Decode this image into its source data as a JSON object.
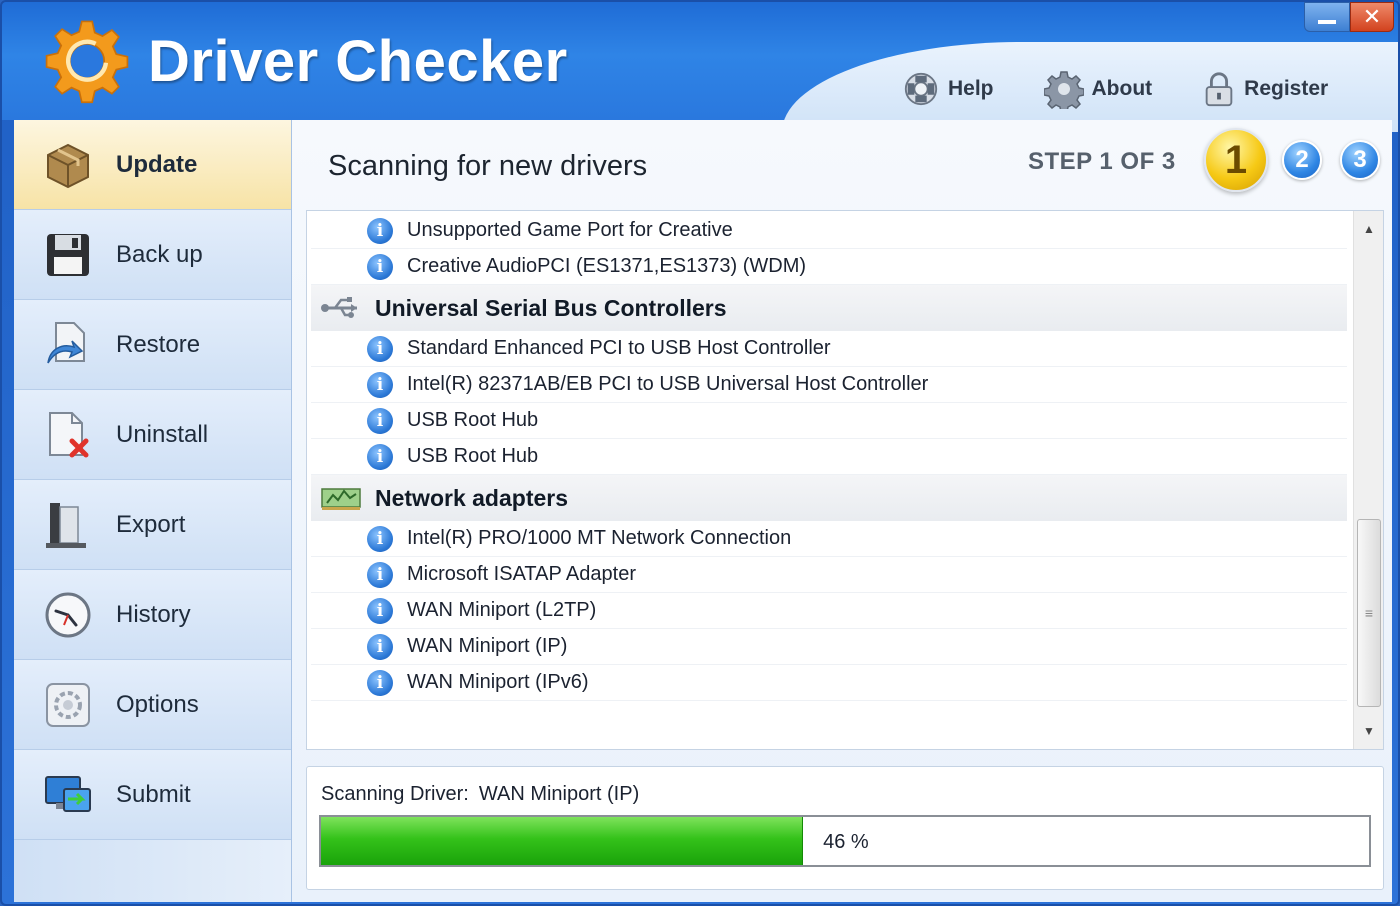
{
  "app": {
    "title": "Driver Checker",
    "window_controls": {
      "minimize": "",
      "close": "✕"
    }
  },
  "top_nav": [
    {
      "label": "Help",
      "icon": "help-lifebuoy-icon"
    },
    {
      "label": "About",
      "icon": "gear-icon"
    },
    {
      "label": "Register",
      "icon": "lock-icon"
    }
  ],
  "sidebar": {
    "items": [
      {
        "label": "Update",
        "icon": "box-icon",
        "active": true
      },
      {
        "label": "Back up",
        "icon": "floppy-disk-icon"
      },
      {
        "label": "Restore",
        "icon": "restore-icon"
      },
      {
        "label": "Uninstall",
        "icon": "document-delete-icon"
      },
      {
        "label": "Export",
        "icon": "export-icon"
      },
      {
        "label": "History",
        "icon": "clock-icon"
      },
      {
        "label": "Options",
        "icon": "options-icon"
      },
      {
        "label": "Submit",
        "icon": "monitor-submit-icon"
      }
    ]
  },
  "main": {
    "title": "Scanning for new drivers",
    "step_label": "STEP 1 OF 3",
    "steps": [
      "1",
      "2",
      "3"
    ],
    "current_step": 1
  },
  "driver_list": [
    {
      "type": "item",
      "label": "Unsupported Game Port for Creative"
    },
    {
      "type": "item",
      "label": "Creative AudioPCI (ES1371,ES1373) (WDM)"
    },
    {
      "type": "category",
      "label": "Universal Serial Bus Controllers",
      "icon": "usb-icon"
    },
    {
      "type": "item",
      "label": "Standard Enhanced PCI to USB Host Controller"
    },
    {
      "type": "item",
      "label": "Intel(R) 82371AB/EB PCI to USB Universal Host Controller"
    },
    {
      "type": "item",
      "label": "USB Root Hub"
    },
    {
      "type": "item",
      "label": "USB Root Hub"
    },
    {
      "type": "category",
      "label": "Network adapters",
      "icon": "network-card-icon"
    },
    {
      "type": "item",
      "label": "Intel(R) PRO/1000 MT Network Connection"
    },
    {
      "type": "item",
      "label": "Microsoft ISATAP Adapter"
    },
    {
      "type": "item",
      "label": "WAN Miniport (L2TP)"
    },
    {
      "type": "item",
      "label": "WAN Miniport (IP)"
    },
    {
      "type": "item",
      "label": "WAN Miniport (IPv6)"
    }
  ],
  "status": {
    "label": "Scanning Driver:",
    "current_driver": "WAN Miniport (IP)",
    "progress_percent": 46,
    "progress_text": "46 %",
    "progress_color": "#34c21a"
  },
  "colors": {
    "header_blue": "#2f84e6",
    "active_item": "#f7e3a6",
    "info_icon_blue": "#2b78d6"
  }
}
